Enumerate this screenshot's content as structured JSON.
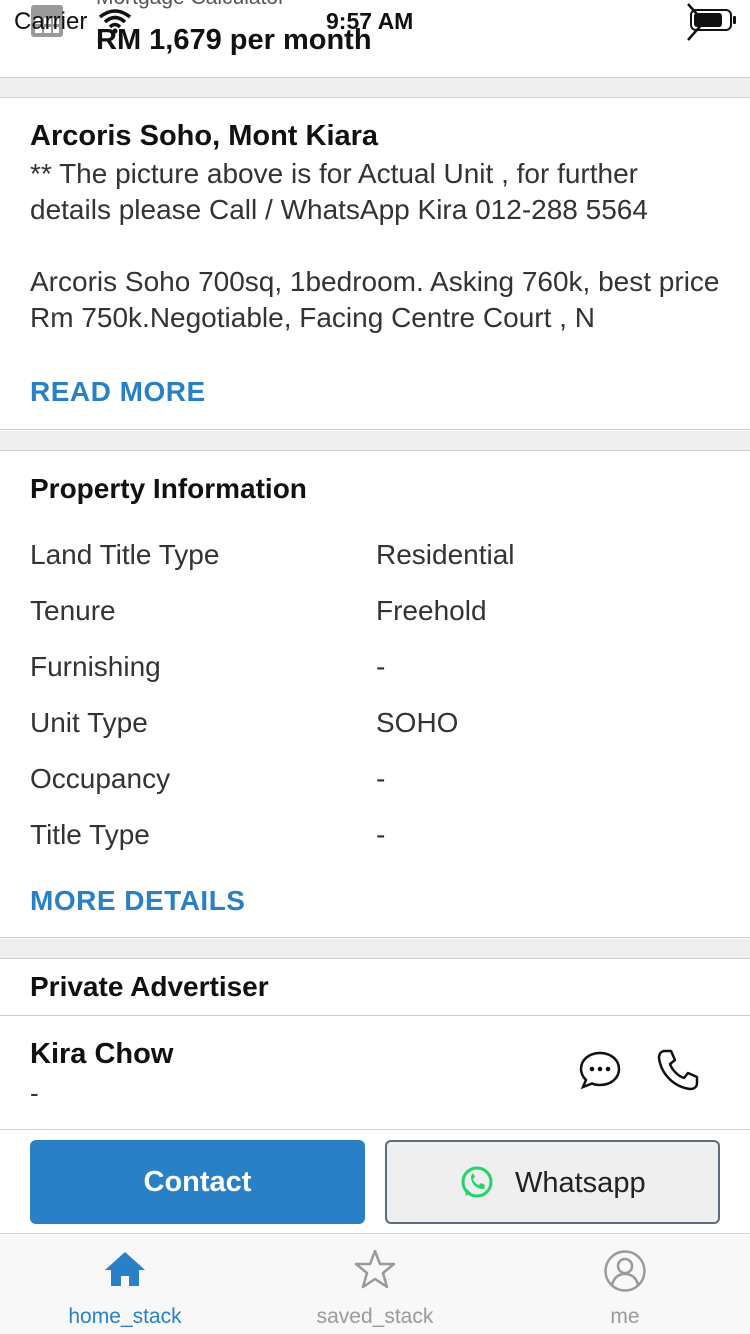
{
  "status_bar": {
    "carrier": "Carrier",
    "time": "9:57 AM"
  },
  "mortgage": {
    "label": "Mortgage Calculator",
    "value": "RM 1,679 per month"
  },
  "listing": {
    "title": "Arcoris Soho, Mont Kiara",
    "description": "** The picture above is for Actual Unit , for further details please Call / WhatsApp Kira 012-288 5564\n\nArcoris Soho 700sq, 1bedroom. Asking 760k, best price Rm 750k.Negotiable,  Facing Centre Court , N",
    "read_more": "READ MORE"
  },
  "property_info": {
    "title": "Property Information",
    "rows": [
      {
        "key": "Land Title Type",
        "value": "Residential"
      },
      {
        "key": "Tenure",
        "value": "Freehold"
      },
      {
        "key": "Furnishing",
        "value": "-"
      },
      {
        "key": "Unit Type",
        "value": "SOHO"
      },
      {
        "key": "Occupancy",
        "value": "-"
      },
      {
        "key": "Title Type",
        "value": "-"
      }
    ],
    "more_details": "MORE DETAILS"
  },
  "advertiser": {
    "heading": "Private Advertiser",
    "name": "Kira Chow",
    "subtitle": "-"
  },
  "actions": {
    "contact": "Contact",
    "whatsapp": "Whatsapp"
  },
  "tabs": [
    {
      "label": "home_stack",
      "icon": "home-icon",
      "active": true
    },
    {
      "label": "saved_stack",
      "icon": "star-icon",
      "active": false
    },
    {
      "label": "me",
      "icon": "user-icon",
      "active": false
    }
  ],
  "colors": {
    "accent": "#2a80c6",
    "whatsapp_green": "#25d366",
    "inactive_tab": "#9a9a9a",
    "section_gap": "#efefef"
  }
}
